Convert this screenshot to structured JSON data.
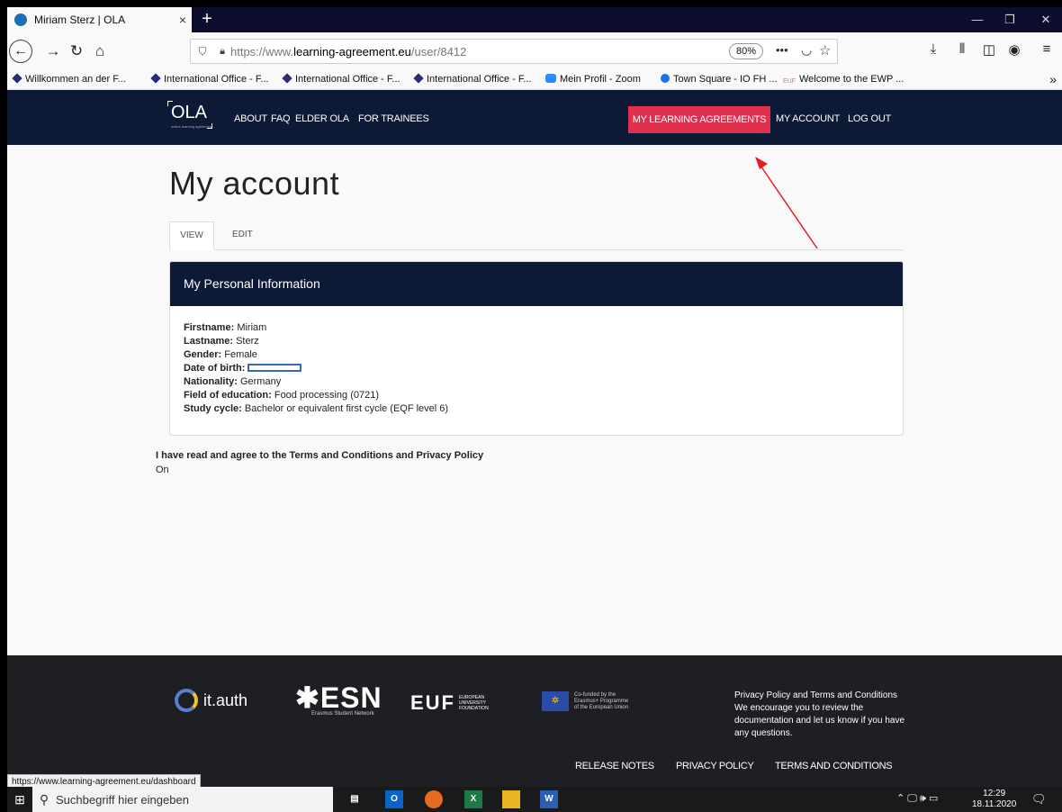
{
  "browser": {
    "tab_title": "Miriam Sterz | OLA",
    "tab_close": "×",
    "new_tab": "+",
    "url_prefix": "https://www.",
    "url_domain": "learning-agreement.eu",
    "url_path": "/user/8412",
    "zoom": "80%",
    "bookmarks": [
      "Willkommen an der F...",
      "International Office - F...",
      "International Office - F...",
      "International Office - F...",
      "Mein Profil - Zoom",
      "Town Square - IO FH ...",
      "Welcome to the EWP ..."
    ],
    "euf_favicon": "EUF",
    "status_url": "https://www.learning-agreement.eu/dashboard"
  },
  "site": {
    "logo": "OLA",
    "logo_sub": "online learning agreement",
    "nav": [
      "ABOUT",
      "FAQ",
      "ELDER OLA",
      "FOR TRAINEES"
    ],
    "nav_right": [
      "MY LEARNING AGREEMENTS",
      "MY ACCOUNT",
      "LOG OUT"
    ]
  },
  "main": {
    "title": "My account",
    "tabs": [
      "VIEW",
      "EDIT"
    ],
    "card_title": "My Personal Information",
    "fields": {
      "firstname_label": "Firstname:",
      "firstname": "Miriam",
      "lastname_label": "Lastname:",
      "lastname": "Sterz",
      "gender_label": "Gender:",
      "gender": "Female",
      "dob_label": "Date of birth:",
      "nationality_label": "Nationality:",
      "nationality": "Germany",
      "field_label": "Field of education:",
      "field": "Food processing (0721)",
      "cycle_label": "Study cycle:",
      "cycle": "Bachelor or equivalent first cycle (EQF level 6)"
    },
    "terms_label": "I have read and agree to the Terms and Conditions and Privacy Policy",
    "terms_value": "On"
  },
  "footer": {
    "itauth": "it.auth",
    "esn": "ESN",
    "esn_sub": "Erasmus Student Network",
    "euf": "EUF",
    "euf_sub": [
      "EUROPEAN",
      "UNIVERSITY",
      "FOUNDATION"
    ],
    "eu_text": [
      "Co-funded by the",
      "Erasmus+ Programme",
      "of the European Union"
    ],
    "privacy_title": "Privacy Policy and Terms and Conditions",
    "privacy_text": "We encourage you to review the documentation and let us know if you have any questions.",
    "links": [
      "RELEASE NOTES",
      "PRIVACY POLICY",
      "TERMS AND CONDITIONS"
    ]
  },
  "taskbar": {
    "search_placeholder": "Suchbegriff hier eingeben",
    "outlook_label": "O",
    "excel_label": "X",
    "word_label": "W",
    "time": "12:29",
    "date": "18.11.2020"
  },
  "colors": {
    "header_bg": "#0c1a36",
    "accent": "#e0304e",
    "footer_bg": "#1e1f22",
    "annotation": "#e02020"
  }
}
